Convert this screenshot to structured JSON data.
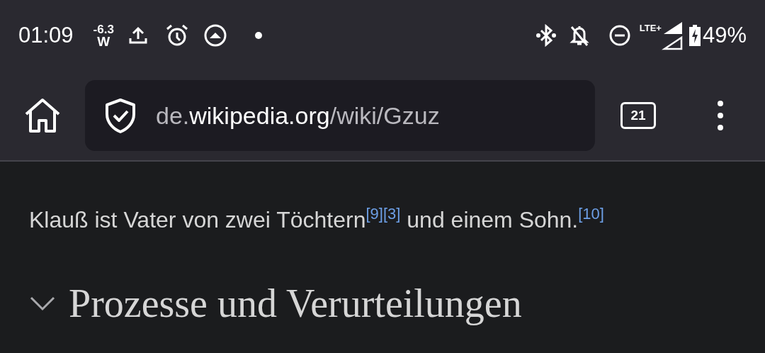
{
  "status_bar": {
    "time": "01:09",
    "power_reading": {
      "value": "-6.3",
      "unit": "W"
    },
    "network": "LTE+",
    "battery": "49%"
  },
  "toolbar": {
    "url": {
      "prefix": "de.",
      "domain": "wikipedia.org",
      "path": "/wiki/Gzuz"
    },
    "tab_count": "21"
  },
  "article": {
    "paragraph": [
      {
        "kind": "text",
        "text": "Klauß ist Vater von zwei Töchtern"
      },
      {
        "kind": "ref",
        "text": "[9]"
      },
      {
        "kind": "ref",
        "text": "[3]"
      },
      {
        "kind": "text",
        "text": " und einem Sohn."
      },
      {
        "kind": "ref",
        "text": "[10]"
      }
    ],
    "section": {
      "heading": "Prozesse und Verurteilungen",
      "expanded": true
    }
  }
}
